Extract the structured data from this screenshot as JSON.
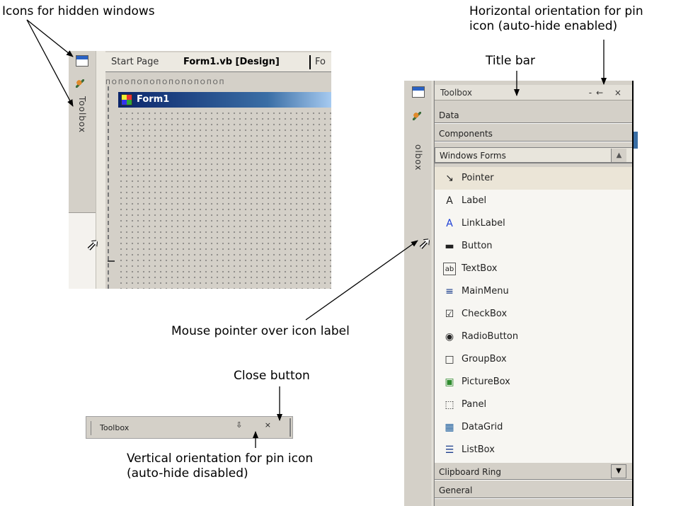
{
  "annotations": {
    "icons_hidden": "Icons for hidden windows",
    "horizontal_pin_line1": "Horizontal orientation for pin",
    "horizontal_pin_line2": "icon (auto-hide enabled)",
    "title_bar": "Title bar",
    "mouse_pointer": "Mouse pointer over icon label",
    "close_button": "Close button",
    "vertical_pin_line1": "Vertical orientation for pin icon",
    "vertical_pin_line2": "(auto-hide disabled)"
  },
  "ide": {
    "tabs": [
      "Start Page",
      "Form1.vb [Design]",
      "Fo"
    ],
    "side_label": "Toolbox",
    "form_title": "Form1",
    "ruler": "ПОПОПОПОПОПОПОПОПОП"
  },
  "toolbox": {
    "title": "Toolbox",
    "title_buttons": "-← ×",
    "side_label": "olbox",
    "categories_top": [
      "Data",
      "Components",
      "Windows Forms"
    ],
    "tools": [
      {
        "label": "Pointer",
        "icon": "pointer-icon",
        "glyph": "↘"
      },
      {
        "label": "Label",
        "icon": "label-icon",
        "glyph": "A"
      },
      {
        "label": "LinkLabel",
        "icon": "linklabel-icon",
        "glyph": "A"
      },
      {
        "label": "Button",
        "icon": "button-icon",
        "glyph": "▬"
      },
      {
        "label": "TextBox",
        "icon": "textbox-icon",
        "glyph": "ab"
      },
      {
        "label": "MainMenu",
        "icon": "mainmenu-icon",
        "glyph": "≡"
      },
      {
        "label": "CheckBox",
        "icon": "checkbox-icon",
        "glyph": "☑"
      },
      {
        "label": "RadioButton",
        "icon": "radiobutton-icon",
        "glyph": "◉"
      },
      {
        "label": "GroupBox",
        "icon": "groupbox-icon",
        "glyph": "□"
      },
      {
        "label": "PictureBox",
        "icon": "picturebox-icon",
        "glyph": "▣"
      },
      {
        "label": "Panel",
        "icon": "panel-icon",
        "glyph": "⬚"
      },
      {
        "label": "DataGrid",
        "icon": "datagrid-icon",
        "glyph": "▦"
      },
      {
        "label": "ListBox",
        "icon": "listbox-icon",
        "glyph": "☰"
      }
    ],
    "categories_bottom": [
      "Clipboard Ring",
      "General"
    ]
  },
  "minibar": {
    "title": "Toolbox",
    "buttons": "⇩ ×"
  }
}
